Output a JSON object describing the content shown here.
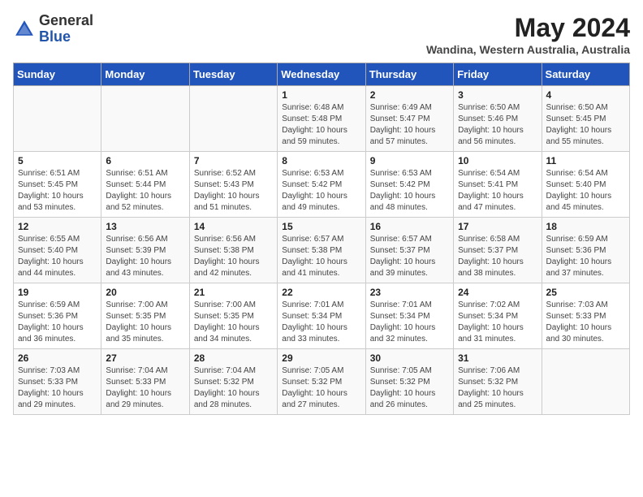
{
  "header": {
    "logo_general": "General",
    "logo_blue": "Blue",
    "month_year": "May 2024",
    "location": "Wandina, Western Australia, Australia"
  },
  "days_of_week": [
    "Sunday",
    "Monday",
    "Tuesday",
    "Wednesday",
    "Thursday",
    "Friday",
    "Saturday"
  ],
  "weeks": [
    [
      {
        "day": "",
        "info": ""
      },
      {
        "day": "",
        "info": ""
      },
      {
        "day": "",
        "info": ""
      },
      {
        "day": "1",
        "info": "Sunrise: 6:48 AM\nSunset: 5:48 PM\nDaylight: 10 hours\nand 59 minutes."
      },
      {
        "day": "2",
        "info": "Sunrise: 6:49 AM\nSunset: 5:47 PM\nDaylight: 10 hours\nand 57 minutes."
      },
      {
        "day": "3",
        "info": "Sunrise: 6:50 AM\nSunset: 5:46 PM\nDaylight: 10 hours\nand 56 minutes."
      },
      {
        "day": "4",
        "info": "Sunrise: 6:50 AM\nSunset: 5:45 PM\nDaylight: 10 hours\nand 55 minutes."
      }
    ],
    [
      {
        "day": "5",
        "info": "Sunrise: 6:51 AM\nSunset: 5:45 PM\nDaylight: 10 hours\nand 53 minutes."
      },
      {
        "day": "6",
        "info": "Sunrise: 6:51 AM\nSunset: 5:44 PM\nDaylight: 10 hours\nand 52 minutes."
      },
      {
        "day": "7",
        "info": "Sunrise: 6:52 AM\nSunset: 5:43 PM\nDaylight: 10 hours\nand 51 minutes."
      },
      {
        "day": "8",
        "info": "Sunrise: 6:53 AM\nSunset: 5:42 PM\nDaylight: 10 hours\nand 49 minutes."
      },
      {
        "day": "9",
        "info": "Sunrise: 6:53 AM\nSunset: 5:42 PM\nDaylight: 10 hours\nand 48 minutes."
      },
      {
        "day": "10",
        "info": "Sunrise: 6:54 AM\nSunset: 5:41 PM\nDaylight: 10 hours\nand 47 minutes."
      },
      {
        "day": "11",
        "info": "Sunrise: 6:54 AM\nSunset: 5:40 PM\nDaylight: 10 hours\nand 45 minutes."
      }
    ],
    [
      {
        "day": "12",
        "info": "Sunrise: 6:55 AM\nSunset: 5:40 PM\nDaylight: 10 hours\nand 44 minutes."
      },
      {
        "day": "13",
        "info": "Sunrise: 6:56 AM\nSunset: 5:39 PM\nDaylight: 10 hours\nand 43 minutes."
      },
      {
        "day": "14",
        "info": "Sunrise: 6:56 AM\nSunset: 5:38 PM\nDaylight: 10 hours\nand 42 minutes."
      },
      {
        "day": "15",
        "info": "Sunrise: 6:57 AM\nSunset: 5:38 PM\nDaylight: 10 hours\nand 41 minutes."
      },
      {
        "day": "16",
        "info": "Sunrise: 6:57 AM\nSunset: 5:37 PM\nDaylight: 10 hours\nand 39 minutes."
      },
      {
        "day": "17",
        "info": "Sunrise: 6:58 AM\nSunset: 5:37 PM\nDaylight: 10 hours\nand 38 minutes."
      },
      {
        "day": "18",
        "info": "Sunrise: 6:59 AM\nSunset: 5:36 PM\nDaylight: 10 hours\nand 37 minutes."
      }
    ],
    [
      {
        "day": "19",
        "info": "Sunrise: 6:59 AM\nSunset: 5:36 PM\nDaylight: 10 hours\nand 36 minutes."
      },
      {
        "day": "20",
        "info": "Sunrise: 7:00 AM\nSunset: 5:35 PM\nDaylight: 10 hours\nand 35 minutes."
      },
      {
        "day": "21",
        "info": "Sunrise: 7:00 AM\nSunset: 5:35 PM\nDaylight: 10 hours\nand 34 minutes."
      },
      {
        "day": "22",
        "info": "Sunrise: 7:01 AM\nSunset: 5:34 PM\nDaylight: 10 hours\nand 33 minutes."
      },
      {
        "day": "23",
        "info": "Sunrise: 7:01 AM\nSunset: 5:34 PM\nDaylight: 10 hours\nand 32 minutes."
      },
      {
        "day": "24",
        "info": "Sunrise: 7:02 AM\nSunset: 5:34 PM\nDaylight: 10 hours\nand 31 minutes."
      },
      {
        "day": "25",
        "info": "Sunrise: 7:03 AM\nSunset: 5:33 PM\nDaylight: 10 hours\nand 30 minutes."
      }
    ],
    [
      {
        "day": "26",
        "info": "Sunrise: 7:03 AM\nSunset: 5:33 PM\nDaylight: 10 hours\nand 29 minutes."
      },
      {
        "day": "27",
        "info": "Sunrise: 7:04 AM\nSunset: 5:33 PM\nDaylight: 10 hours\nand 29 minutes."
      },
      {
        "day": "28",
        "info": "Sunrise: 7:04 AM\nSunset: 5:32 PM\nDaylight: 10 hours\nand 28 minutes."
      },
      {
        "day": "29",
        "info": "Sunrise: 7:05 AM\nSunset: 5:32 PM\nDaylight: 10 hours\nand 27 minutes."
      },
      {
        "day": "30",
        "info": "Sunrise: 7:05 AM\nSunset: 5:32 PM\nDaylight: 10 hours\nand 26 minutes."
      },
      {
        "day": "31",
        "info": "Sunrise: 7:06 AM\nSunset: 5:32 PM\nDaylight: 10 hours\nand 25 minutes."
      },
      {
        "day": "",
        "info": ""
      }
    ]
  ]
}
